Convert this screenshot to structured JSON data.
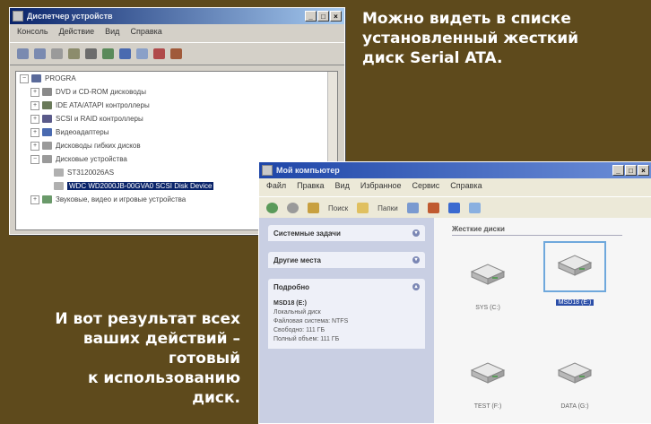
{
  "captions": {
    "top_lines": [
      "Можно видеть в списке",
      "установленный жесткий",
      "диск Serial ATA."
    ],
    "bottom_lines": [
      "И вот результат всех",
      "ваших действий –",
      "готовый",
      "к использованию",
      "диск."
    ]
  },
  "device_manager": {
    "title": "Диспетчер устройств",
    "menu": [
      "Консоль",
      "Действие",
      "Вид",
      "Справка"
    ],
    "tree": [
      {
        "label": "PROGRA",
        "expander": "−"
      },
      {
        "label": "DVD и CD-ROM дисководы",
        "expander": "+"
      },
      {
        "label": "IDE ATA/ATAPI контроллеры",
        "expander": "+"
      },
      {
        "label": "SCSI и RAID контроллеры",
        "expander": "+"
      },
      {
        "label": "Видеоадаптеры",
        "expander": "+"
      },
      {
        "label": "Дисководы гибких дисков",
        "expander": "+"
      },
      {
        "label": "Дисковые устройства",
        "expander": "−"
      },
      {
        "label": "ST3120026AS",
        "expander": ""
      },
      {
        "label": "WDC WD2000JB-00GVA0 SCSI Disk Device",
        "expander": ""
      },
      {
        "label": "Звуковые, видео и игровые устройства",
        "expander": "+"
      }
    ],
    "window_buttons": [
      "_",
      "□",
      "×"
    ]
  },
  "my_computer": {
    "title": "Мой компьютер",
    "menu": [
      "Файл",
      "Правка",
      "Вид",
      "Избранное",
      "Сервис",
      "Справка"
    ],
    "toolbar": [
      "Назад",
      "Поиск",
      "Папки"
    ],
    "tasks": [
      "Системные задачи",
      "Другие места",
      "Подробно"
    ],
    "details": {
      "name": "MSD18 (E:)",
      "type": "Локальный диск",
      "fs": "Файловая система: NTFS",
      "free": "Свободно: 111 ГБ",
      "total": "Полный объем: 111 ГБ"
    },
    "group_title": "Жесткие диски",
    "drives": [
      {
        "label": "SYS (C:)",
        "selected": false
      },
      {
        "label": "MSD18 (E:)",
        "selected": true
      },
      {
        "label": "TEST (F:)",
        "selected": false
      },
      {
        "label": "DATA (G:)",
        "selected": false
      }
    ],
    "window_buttons": [
      "_",
      "□",
      "×"
    ]
  },
  "colors": {
    "background": "#5e4a1c",
    "caption": "#ffffff",
    "titlebar": "#0a246a",
    "selection": "#2b4ea8"
  }
}
